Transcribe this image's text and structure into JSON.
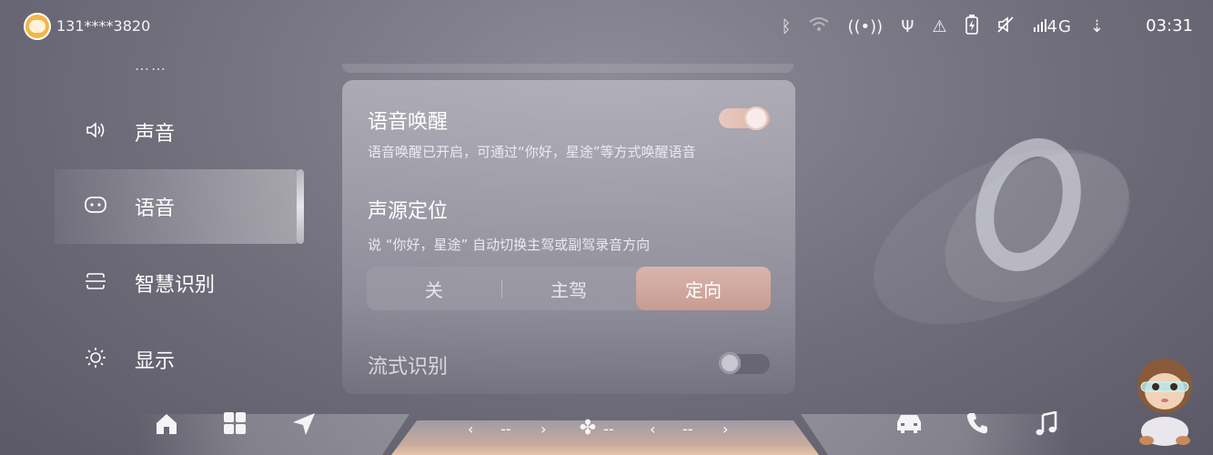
{
  "status_bar": {
    "user_id": "131****3820",
    "avatar_icon": "tiger-avatar-icon",
    "network_label": "4G",
    "time": "03:31",
    "icons": [
      "bluetooth-icon",
      "wifi-icon",
      "hotspot-icon",
      "usb-icon",
      "warning-icon",
      "battery-charging-icon",
      "mute-icon",
      "signal-icon",
      "download-icon"
    ]
  },
  "sidebar": {
    "top_partial": "……",
    "items": [
      {
        "label": "声音",
        "icon": "speaker-icon",
        "active": false
      },
      {
        "label": "语音",
        "icon": "voice-assistant-icon",
        "active": true
      },
      {
        "label": "智慧识别",
        "icon": "recognition-icon",
        "active": false
      },
      {
        "label": "显示",
        "icon": "brightness-icon",
        "active": false
      }
    ]
  },
  "panel": {
    "voice_wake": {
      "title": "语音唤醒",
      "desc": "语音唤醒已开启，可通过“你好，星途”等方式唤醒语音",
      "enabled": true
    },
    "sound_source": {
      "title": "声源定位",
      "desc": "说 “你好，星途” 自动切换主驾或副驾录音方向",
      "options": [
        "关",
        "主驾",
        "定向"
      ],
      "selected": "定向"
    },
    "streaming": {
      "title": "流式识别",
      "enabled": false
    }
  },
  "dock": {
    "left_icons": [
      "home-icon",
      "apps-icon",
      "navigation-icon"
    ],
    "right_icons": [
      "car-icon",
      "phone-icon",
      "music-icon"
    ],
    "climate": {
      "left_temp": "--",
      "fan": "--",
      "right_temp": "--",
      "prev": "‹",
      "next": "›"
    }
  },
  "colors": {
    "accent": "#d9b5ac",
    "background": "#6f6d7a"
  }
}
